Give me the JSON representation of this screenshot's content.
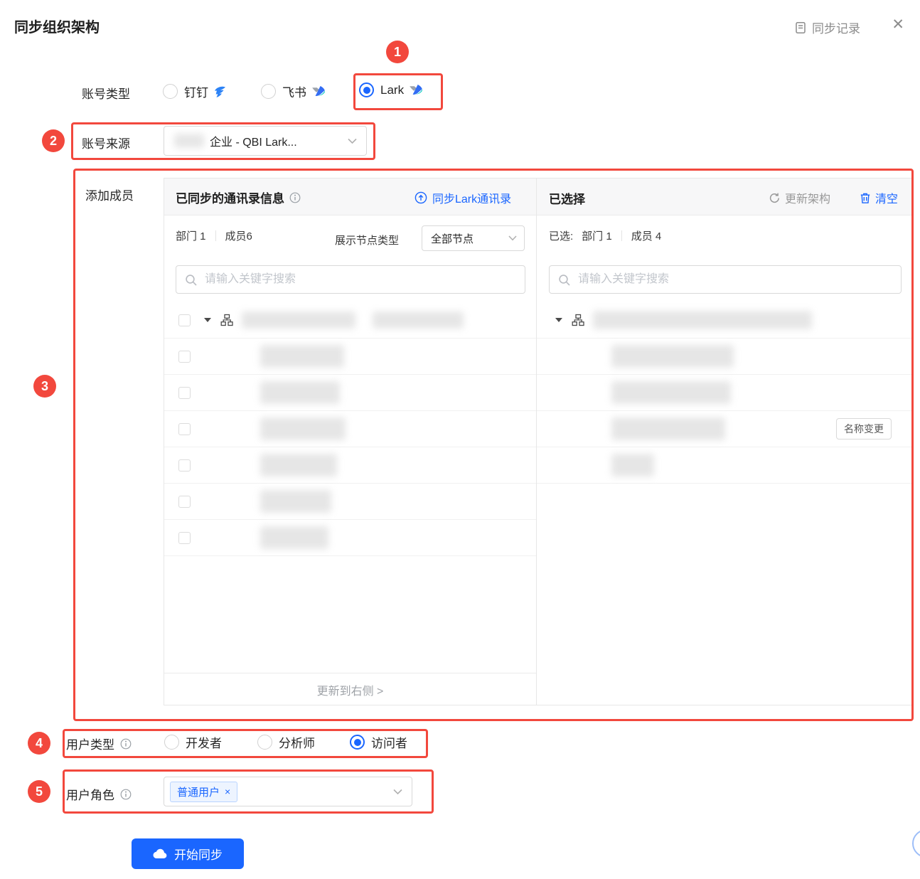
{
  "page": {
    "title": "同步组织架构"
  },
  "header": {
    "sync_log_label": "同步记录",
    "close_glyph": "✕"
  },
  "account_type": {
    "label": "账号类型",
    "options": [
      {
        "label": "钉钉",
        "selected": false
      },
      {
        "label": "飞书",
        "selected": false
      },
      {
        "label": "Lark",
        "selected": true
      }
    ]
  },
  "account_source": {
    "label": "账号来源",
    "value": "企业 - QBI Lark..."
  },
  "transfer": {
    "section_label": "添加成员",
    "left": {
      "title": "已同步的通讯录信息",
      "sync_link": "同步Lark通讯录",
      "dept_stat": "部门 1",
      "member_stat": "成员6",
      "node_type_label": "展示节点类型",
      "node_type_value": "全部节点",
      "search_placeholder": "请输入关键字搜索",
      "footer_action": "更新到右侧 >"
    },
    "right": {
      "title": "已选择",
      "refresh_label": "更新架构",
      "clear_label": "清空",
      "selected_prefix": "已选:",
      "dept_stat": "部门 1",
      "member_stat": "成员 4",
      "search_placeholder": "请输入关键字搜索",
      "name_change_badge": "名称变更"
    }
  },
  "user_type": {
    "label": "用户类型",
    "options": [
      {
        "label": "开发者",
        "selected": false
      },
      {
        "label": "分析师",
        "selected": false
      },
      {
        "label": "访问者",
        "selected": true
      }
    ]
  },
  "user_role": {
    "label": "用户角色",
    "tag": "普通用户",
    "tag_close": "×"
  },
  "actions": {
    "submit_label": "开始同步"
  },
  "annotations": {
    "n1": "1",
    "n2": "2",
    "n3": "3",
    "n4": "4",
    "n5": "5"
  },
  "colors": {
    "accent_blue": "#1A66FF",
    "annotation_red": "#F2483D"
  }
}
